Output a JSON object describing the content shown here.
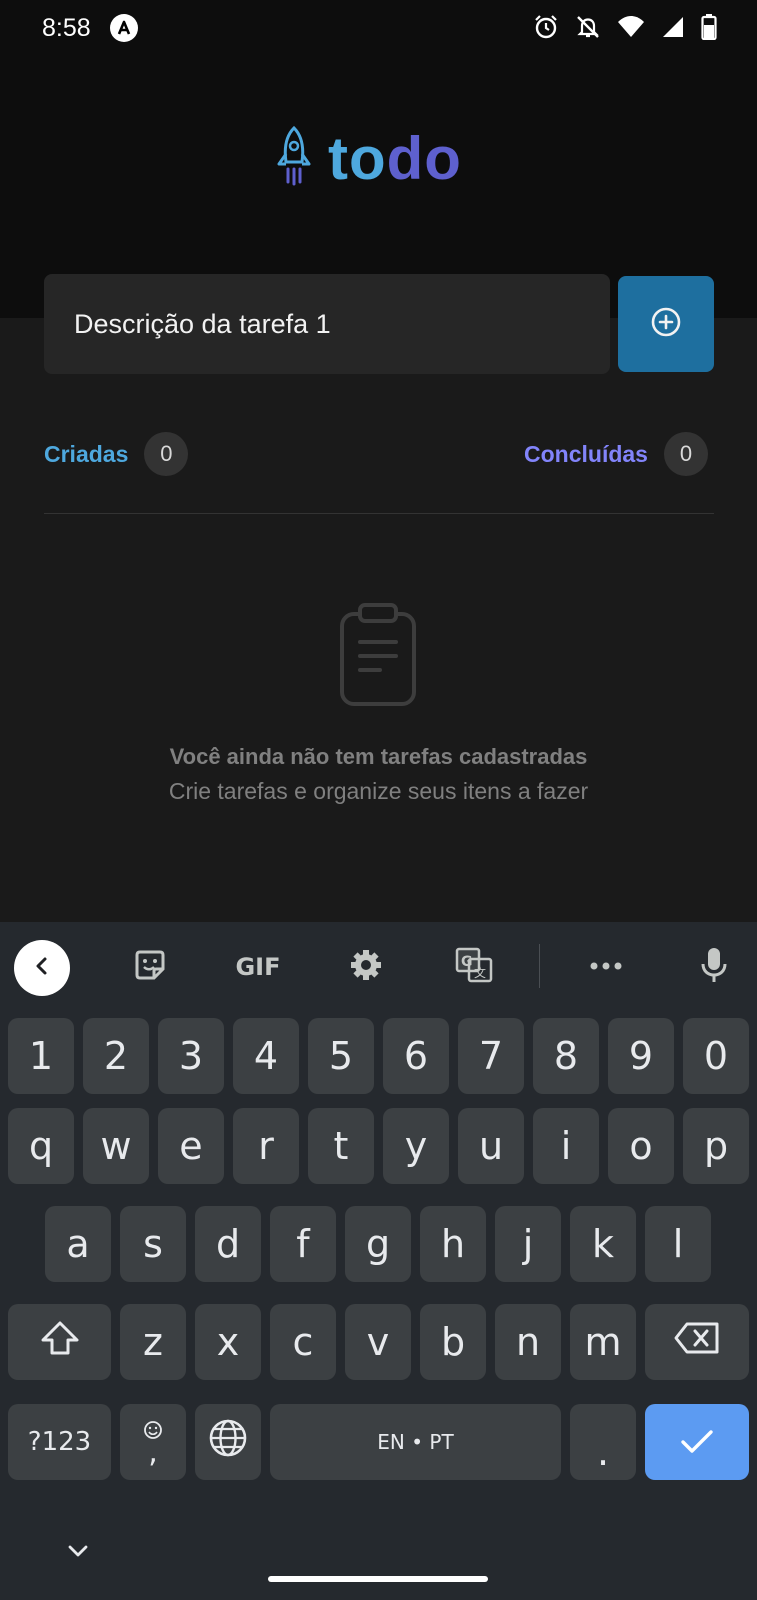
{
  "status_bar": {
    "time": "8:58",
    "icons": [
      "a-circle-icon",
      "alarm-icon",
      "bell-off-icon",
      "wifi-icon",
      "signal-icon",
      "battery-icon"
    ]
  },
  "app": {
    "logo_part1": "to",
    "logo_part2": "do",
    "logo_icon": "rocket-icon",
    "colors": {
      "blue": "#4ea8de",
      "purple": "#5e60ce",
      "purple_light": "#8284fa",
      "button": "#1e6f9f"
    }
  },
  "new_task": {
    "value": "Descrição da tarefa 1",
    "add_icon": "plus-circle-icon"
  },
  "counters": {
    "created_label": "Criadas",
    "created_count": "0",
    "done_label": "Concluídas",
    "done_count": "0"
  },
  "empty_state": {
    "icon": "clipboard-icon",
    "title": "Você ainda não tem tarefas cadastradas",
    "subtitle": "Crie tarefas e organize seus itens a fazer"
  },
  "keyboard": {
    "toolbar": [
      "back-icon",
      "sticker-icon",
      "GIF",
      "gear-icon",
      "translate-icon",
      "more-icon",
      "mic-icon"
    ],
    "gif_label": "GIF",
    "row_numbers": [
      "1",
      "2",
      "3",
      "4",
      "5",
      "6",
      "7",
      "8",
      "9",
      "0"
    ],
    "row1": [
      "q",
      "w",
      "e",
      "r",
      "t",
      "y",
      "u",
      "i",
      "o",
      "p"
    ],
    "row2": [
      "a",
      "s",
      "d",
      "f",
      "g",
      "h",
      "j",
      "k",
      "l"
    ],
    "row3": [
      "z",
      "x",
      "c",
      "v",
      "b",
      "n",
      "m"
    ],
    "symbols_label": "?123",
    "comma_label": ",",
    "space_label": "EN • PT",
    "period_label": ".",
    "enter_color": "#5c9bf2"
  }
}
